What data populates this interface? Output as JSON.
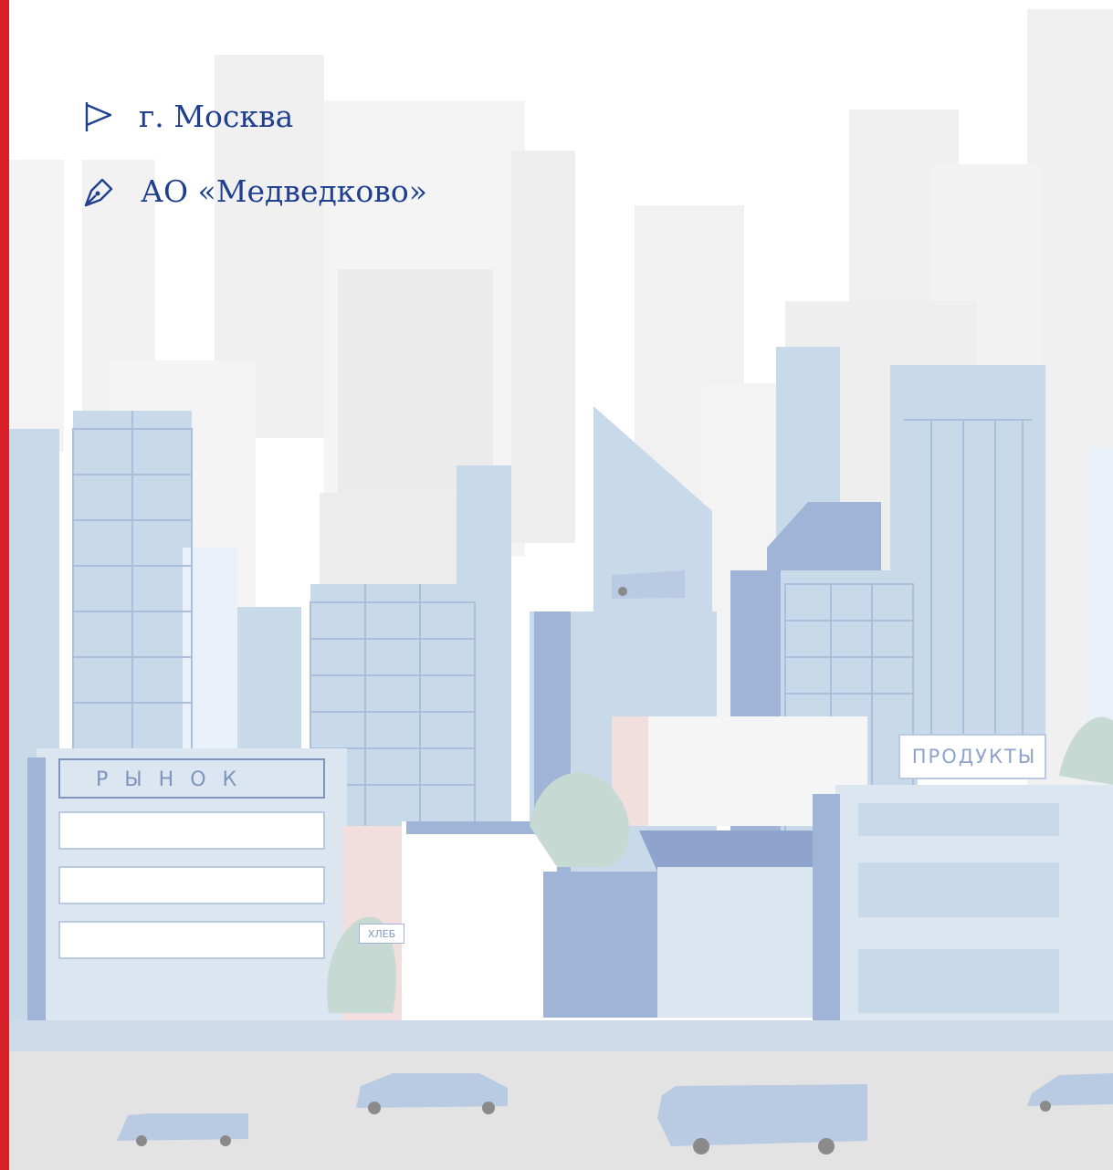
{
  "location": {
    "icon": "flag-icon",
    "city": "г. Москва"
  },
  "organization": {
    "icon": "fountain-pen-icon",
    "name": "АО «Медведково»"
  },
  "signs": {
    "market": "РЫНОК",
    "groceries": "ПРОДУКТЫ",
    "bread": "ХЛЕБ"
  },
  "colors": {
    "accent_red": "#d71f28",
    "text_blue": "#1f3f8f",
    "building_light": "#c8d9ea",
    "building_mid": "#9fb4d6",
    "building_grey": "#ececec",
    "road": "#e3e3e3"
  }
}
